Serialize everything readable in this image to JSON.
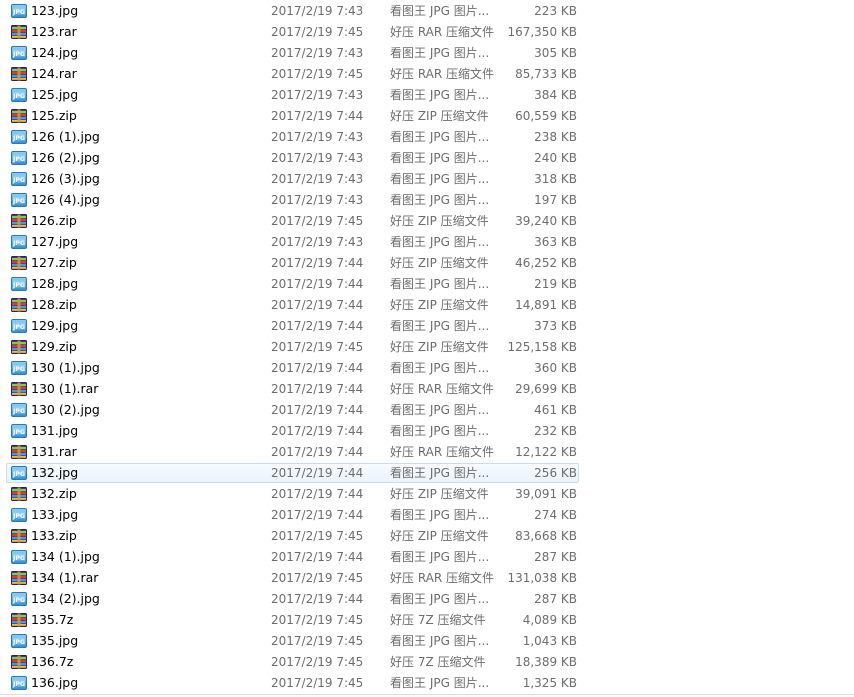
{
  "files": [
    {
      "name": "123.jpg",
      "date": "2017/2/19 7:43",
      "type": "看图王 JPG 图片...",
      "size": "223 KB",
      "icon": "jpg-file-icon"
    },
    {
      "name": "123.rar",
      "date": "2017/2/19 7:45",
      "type": "好压 RAR 压缩文件",
      "size": "167,350 KB",
      "icon": "archive-file-icon"
    },
    {
      "name": "124.jpg",
      "date": "2017/2/19 7:43",
      "type": "看图王 JPG 图片...",
      "size": "305 KB",
      "icon": "jpg-file-icon"
    },
    {
      "name": "124.rar",
      "date": "2017/2/19 7:45",
      "type": "好压 RAR 压缩文件",
      "size": "85,733 KB",
      "icon": "archive-file-icon"
    },
    {
      "name": "125.jpg",
      "date": "2017/2/19 7:43",
      "type": "看图王 JPG 图片...",
      "size": "384 KB",
      "icon": "jpg-file-icon"
    },
    {
      "name": "125.zip",
      "date": "2017/2/19 7:44",
      "type": "好压 ZIP 压缩文件",
      "size": "60,559 KB",
      "icon": "archive-file-icon"
    },
    {
      "name": "126 (1).jpg",
      "date": "2017/2/19 7:43",
      "type": "看图王 JPG 图片...",
      "size": "238 KB",
      "icon": "jpg-file-icon"
    },
    {
      "name": "126 (2).jpg",
      "date": "2017/2/19 7:43",
      "type": "看图王 JPG 图片...",
      "size": "240 KB",
      "icon": "jpg-file-icon"
    },
    {
      "name": "126 (3).jpg",
      "date": "2017/2/19 7:43",
      "type": "看图王 JPG 图片...",
      "size": "318 KB",
      "icon": "jpg-file-icon"
    },
    {
      "name": "126 (4).jpg",
      "date": "2017/2/19 7:43",
      "type": "看图王 JPG 图片...",
      "size": "197 KB",
      "icon": "jpg-file-icon"
    },
    {
      "name": "126.zip",
      "date": "2017/2/19 7:45",
      "type": "好压 ZIP 压缩文件",
      "size": "39,240 KB",
      "icon": "archive-file-icon"
    },
    {
      "name": "127.jpg",
      "date": "2017/2/19 7:43",
      "type": "看图王 JPG 图片...",
      "size": "363 KB",
      "icon": "jpg-file-icon"
    },
    {
      "name": "127.zip",
      "date": "2017/2/19 7:44",
      "type": "好压 ZIP 压缩文件",
      "size": "46,252 KB",
      "icon": "archive-file-icon"
    },
    {
      "name": "128.jpg",
      "date": "2017/2/19 7:44",
      "type": "看图王 JPG 图片...",
      "size": "219 KB",
      "icon": "jpg-file-icon"
    },
    {
      "name": "128.zip",
      "date": "2017/2/19 7:44",
      "type": "好压 ZIP 压缩文件",
      "size": "14,891 KB",
      "icon": "archive-file-icon"
    },
    {
      "name": "129.jpg",
      "date": "2017/2/19 7:44",
      "type": "看图王 JPG 图片...",
      "size": "373 KB",
      "icon": "jpg-file-icon"
    },
    {
      "name": "129.zip",
      "date": "2017/2/19 7:45",
      "type": "好压 ZIP 压缩文件",
      "size": "125,158 KB",
      "icon": "archive-file-icon"
    },
    {
      "name": "130 (1).jpg",
      "date": "2017/2/19 7:44",
      "type": "看图王 JPG 图片...",
      "size": "360 KB",
      "icon": "jpg-file-icon"
    },
    {
      "name": "130 (1).rar",
      "date": "2017/2/19 7:44",
      "type": "好压 RAR 压缩文件",
      "size": "29,699 KB",
      "icon": "archive-file-icon"
    },
    {
      "name": "130 (2).jpg",
      "date": "2017/2/19 7:44",
      "type": "看图王 JPG 图片...",
      "size": "461 KB",
      "icon": "jpg-file-icon"
    },
    {
      "name": "131.jpg",
      "date": "2017/2/19 7:44",
      "type": "看图王 JPG 图片...",
      "size": "232 KB",
      "icon": "jpg-file-icon"
    },
    {
      "name": "131.rar",
      "date": "2017/2/19 7:44",
      "type": "好压 RAR 压缩文件",
      "size": "12,122 KB",
      "icon": "archive-file-icon"
    },
    {
      "name": "132.jpg",
      "date": "2017/2/19 7:44",
      "type": "看图王 JPG 图片...",
      "size": "256 KB",
      "icon": "jpg-file-icon",
      "hovered": true
    },
    {
      "name": "132.zip",
      "date": "2017/2/19 7:44",
      "type": "好压 ZIP 压缩文件",
      "size": "39,091 KB",
      "icon": "archive-file-icon"
    },
    {
      "name": "133.jpg",
      "date": "2017/2/19 7:44",
      "type": "看图王 JPG 图片...",
      "size": "274 KB",
      "icon": "jpg-file-icon"
    },
    {
      "name": "133.zip",
      "date": "2017/2/19 7:45",
      "type": "好压 ZIP 压缩文件",
      "size": "83,668 KB",
      "icon": "archive-file-icon"
    },
    {
      "name": "134 (1).jpg",
      "date": "2017/2/19 7:44",
      "type": "看图王 JPG 图片...",
      "size": "287 KB",
      "icon": "jpg-file-icon"
    },
    {
      "name": "134 (1).rar",
      "date": "2017/2/19 7:45",
      "type": "好压 RAR 压缩文件",
      "size": "131,038 KB",
      "icon": "archive-file-icon"
    },
    {
      "name": "134 (2).jpg",
      "date": "2017/2/19 7:44",
      "type": "看图王 JPG 图片...",
      "size": "287 KB",
      "icon": "jpg-file-icon"
    },
    {
      "name": "135.7z",
      "date": "2017/2/19 7:45",
      "type": "好压 7Z 压缩文件",
      "size": "4,089 KB",
      "icon": "archive-file-icon"
    },
    {
      "name": "135.jpg",
      "date": "2017/2/19 7:45",
      "type": "看图王 JPG 图片...",
      "size": "1,043 KB",
      "icon": "jpg-file-icon"
    },
    {
      "name": "136.7z",
      "date": "2017/2/19 7:45",
      "type": "好压 7Z 压缩文件",
      "size": "18,389 KB",
      "icon": "archive-file-icon"
    },
    {
      "name": "136.jpg",
      "date": "2017/2/19 7:45",
      "type": "看图王 JPG 图片...",
      "size": "1,325 KB",
      "icon": "jpg-file-icon"
    }
  ],
  "colors": {
    "hover_background": "#eaf3fc",
    "hover_border": "#c6dcf3",
    "secondary_text": "#6d6d6d"
  },
  "icon_labels": {
    "jpg": "JPG"
  }
}
